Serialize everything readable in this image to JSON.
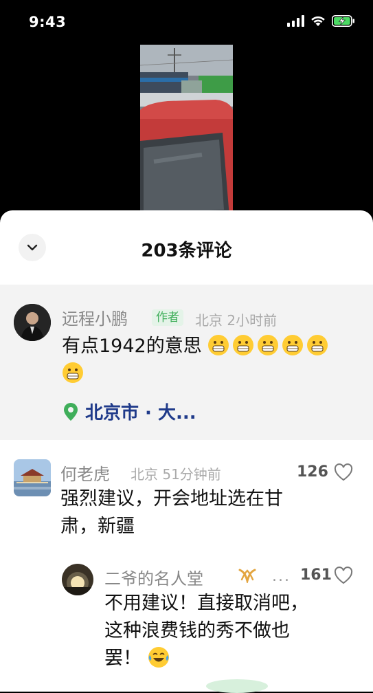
{
  "status_bar": {
    "time": "9:43"
  },
  "colors": {
    "accent_green": "#3fae5a",
    "location_blue": "#1f3a8a",
    "sheet_bg": "#ffffff",
    "pinned_bg": "#f3f3f3"
  },
  "sheet": {
    "title": "203条评论"
  },
  "comments": [
    {
      "username": "远程小鹏",
      "badge": "作者",
      "meta": "北京 2小时前",
      "text_line1": "有点1942的意思",
      "text_emoji": "grinning-emoji",
      "location": "北京市 · 大..."
    },
    {
      "username": "何老虎",
      "meta": "北京 51分钟前",
      "likes": "126",
      "text_line1": "强烈建议，开会地址选在甘",
      "text_line2": "肃，新疆"
    },
    {
      "username": "二爷的名人堂",
      "more": "...",
      "likes": "161",
      "text_line1": "不用建议！直接取消吧，",
      "text_line2": "这种浪费钱的秀不做也",
      "text_line3": "罢！",
      "text_emoji": "crying-laughing-emoji"
    }
  ]
}
